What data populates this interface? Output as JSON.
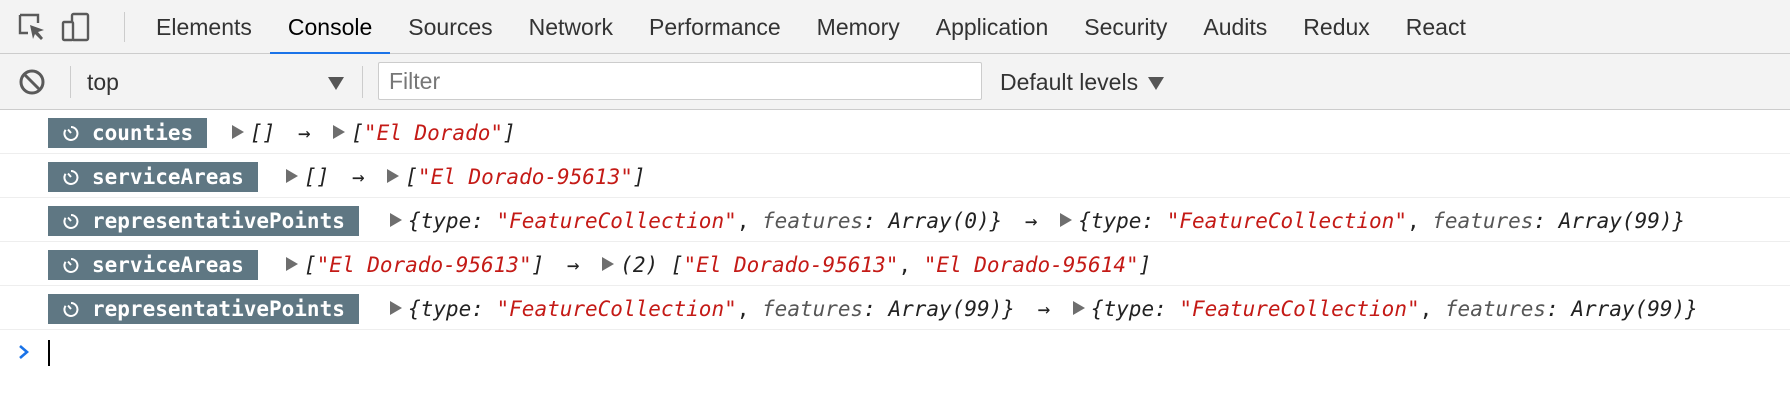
{
  "tabs": [
    {
      "label": "Elements",
      "active": false
    },
    {
      "label": "Console",
      "active": true
    },
    {
      "label": "Sources",
      "active": false
    },
    {
      "label": "Network",
      "active": false
    },
    {
      "label": "Performance",
      "active": false
    },
    {
      "label": "Memory",
      "active": false
    },
    {
      "label": "Application",
      "active": false
    },
    {
      "label": "Security",
      "active": false
    },
    {
      "label": "Audits",
      "active": false
    },
    {
      "label": "Redux",
      "active": false
    },
    {
      "label": "React",
      "active": false
    }
  ],
  "toolbar": {
    "inspect_icon": "inspect-element-icon",
    "device_icon": "device-toolbar-icon",
    "clear_icon": "clear-console-icon",
    "context": "top",
    "filter_placeholder": "Filter",
    "filter_value": "",
    "levels_label": "Default levels"
  },
  "messages": [
    {
      "label": "counties",
      "prev": "[]",
      "next_text": "[",
      "next_str1": "\"El Dorado\"",
      "next_end": "]"
    },
    {
      "label": "serviceAreas",
      "prev": "[]",
      "next_text": "[",
      "next_str1": "\"El Dorado-95613\"",
      "next_end": "]"
    },
    {
      "label": "representativePoints",
      "prev_open": "{type: ",
      "prev_type": "\"FeatureCollection\"",
      "prev_sep": ", ",
      "prev_key": "features",
      "prev_val": ": Array(0)}",
      "next_open": "{type: ",
      "next_type": "\"FeatureCollection\"",
      "next_sep": ", ",
      "next_key": "features",
      "next_val": ": Array(99)}"
    },
    {
      "label": "serviceAreas",
      "prev_open": "[",
      "prev_str": "\"El Dorado-95613\"",
      "prev_close": "]",
      "next_count": "(2) ",
      "next_open": "[",
      "next_str1": "\"El Dorado-95613\"",
      "next_sep": ", ",
      "next_str2": "\"El Dorado-95614\"",
      "next_close": "]"
    },
    {
      "label": "representativePoints",
      "prev_open": "{type: ",
      "prev_type": "\"FeatureCollection\"",
      "prev_sep": ", ",
      "prev_key": "features",
      "prev_val": ": Array(99)}",
      "next_open": "{type: ",
      "next_type": "\"FeatureCollection\"",
      "next_sep": ", ",
      "next_key": "features",
      "next_val": ": Array(99)}"
    }
  ],
  "arrow": "→",
  "colors": {
    "accent": "#1a73e8",
    "badge": "#5f7783",
    "string": "#c41a16",
    "prompt": "#1a73e8"
  }
}
